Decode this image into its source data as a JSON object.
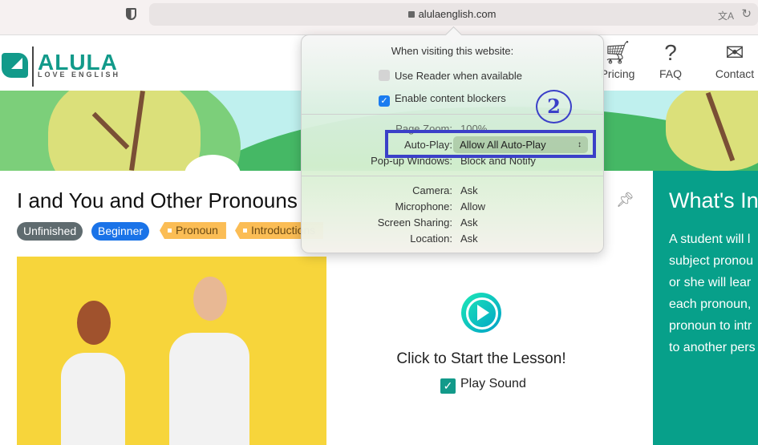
{
  "browser": {
    "url": "alulaenglish.com"
  },
  "logo": {
    "name": "ALULA",
    "tagline": "LOVE ENGLISH"
  },
  "nav": [
    {
      "label": "Pricing",
      "icon": "cart-icon"
    },
    {
      "label": "FAQ",
      "icon": "question-icon"
    },
    {
      "label": "Contact",
      "icon": "envelope-icon"
    }
  ],
  "lesson": {
    "title": "I and You and Other Pronouns",
    "badges": [
      "Unfinished",
      "Beginner"
    ],
    "tags": [
      "Pronoun",
      "Introductions"
    ],
    "start_label": "Click to Start the Lesson!",
    "play_sound_label": "Play Sound",
    "play_sound_checked": true
  },
  "sidebar": {
    "title": "What's Inside",
    "text_lines": [
      "A student will l",
      "subject pronou",
      "or she will lear",
      "each pronoun,",
      "pronoun to intr",
      "to another pers"
    ]
  },
  "popover": {
    "header": "When visiting this website:",
    "reader": {
      "label": "Use Reader when available",
      "checked": false
    },
    "blockers": {
      "label": "Enable content blockers",
      "checked": true
    },
    "page_zoom": {
      "label": "Page Zoom:",
      "value": "100%"
    },
    "autoplay": {
      "label": "Auto-Play:",
      "value": "Allow All Auto-Play"
    },
    "popups": {
      "label": "Pop-up Windows:",
      "value": "Block and Notify"
    },
    "camera": {
      "label": "Camera:",
      "value": "Ask"
    },
    "microphone": {
      "label": "Microphone:",
      "value": "Allow"
    },
    "screen_sharing": {
      "label": "Screen Sharing:",
      "value": "Ask"
    },
    "location": {
      "label": "Location:",
      "value": "Ask"
    }
  },
  "annotation": {
    "step": "2"
  },
  "colors": {
    "brand": "#129a8a",
    "sidebar": "#07a08a",
    "highlight": "#3b40c8",
    "badge_unfinished": "#5f6b6f",
    "badge_beginner": "#1a73e8",
    "tag": "#fbbd55"
  }
}
